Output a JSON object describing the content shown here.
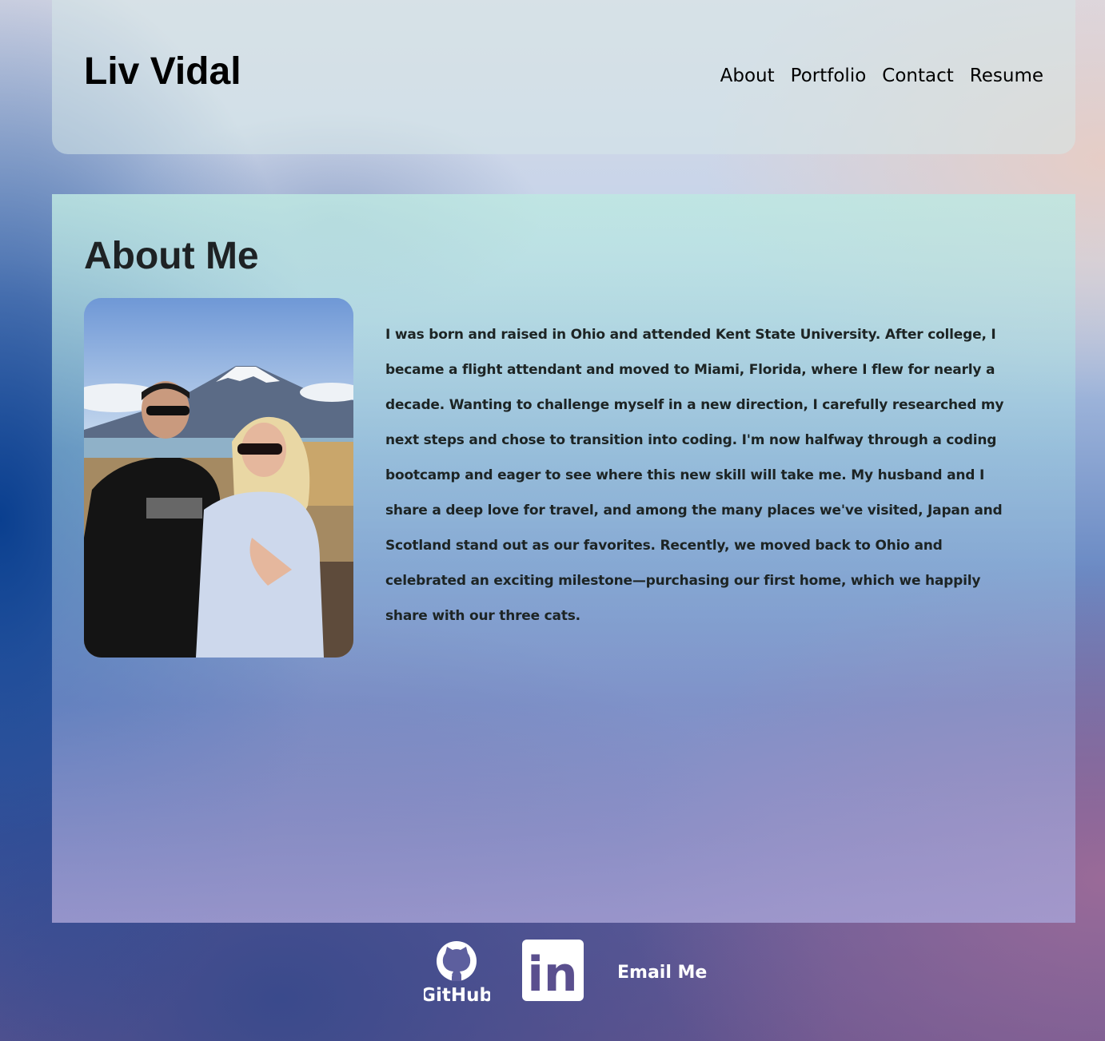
{
  "header": {
    "brand": "Liv Vidal",
    "nav": [
      "About",
      "Portfolio",
      "Contact",
      "Resume"
    ]
  },
  "about": {
    "title": "About Me",
    "photo_alt": "Couple in front of Mount Fuji",
    "bio": "I was born and raised in Ohio and attended Kent State University. After college, I became a flight attendant and moved to Miami, Florida, where I flew for nearly a decade. Wanting to challenge myself in a new direction, I carefully researched my next steps and chose to transition into coding. I'm now halfway through a coding bootcamp and eager to see where this new skill will take me. My husband and I share a deep love for travel, and among the many places we've visited, Japan and Scotland stand out as our favorites. Recently, we moved back to Ohio and celebrated an exciting milestone—purchasing our first home, which we happily share with our three cats."
  },
  "footer": {
    "github_label": "GitHub",
    "linkedin_label": "in",
    "email_label": "Email Me"
  },
  "colors": {
    "text_dark": "#1d2424",
    "footer_text": "#ffffff",
    "header_bg": "#d6e8e8"
  }
}
